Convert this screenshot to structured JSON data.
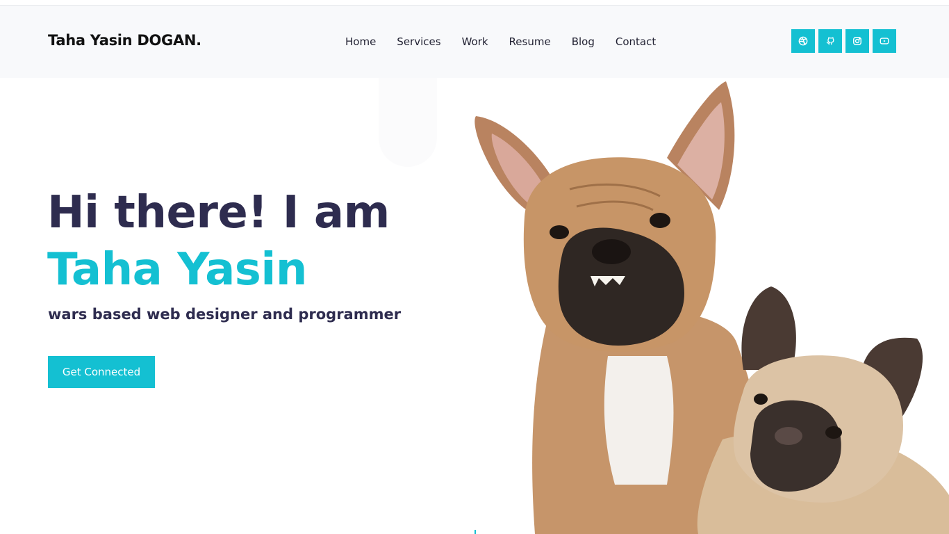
{
  "header": {
    "brand": "Taha Yasin DOGAN.",
    "nav": [
      "Home",
      "Services",
      "Work",
      "Resume",
      "Blog",
      "Contact"
    ],
    "socials": [
      "dribbble-icon",
      "github-icon",
      "instagram-icon",
      "youtube-icon"
    ]
  },
  "hero": {
    "line1": "Hi there! I am",
    "name": "Taha Yasin",
    "subtitle": "wars based web designer and programmer",
    "cta_label": "Get Connected"
  },
  "colors": {
    "accent": "#14c0d2",
    "heading": "#2e2c4f",
    "header_bg": "#f8f9fb"
  }
}
